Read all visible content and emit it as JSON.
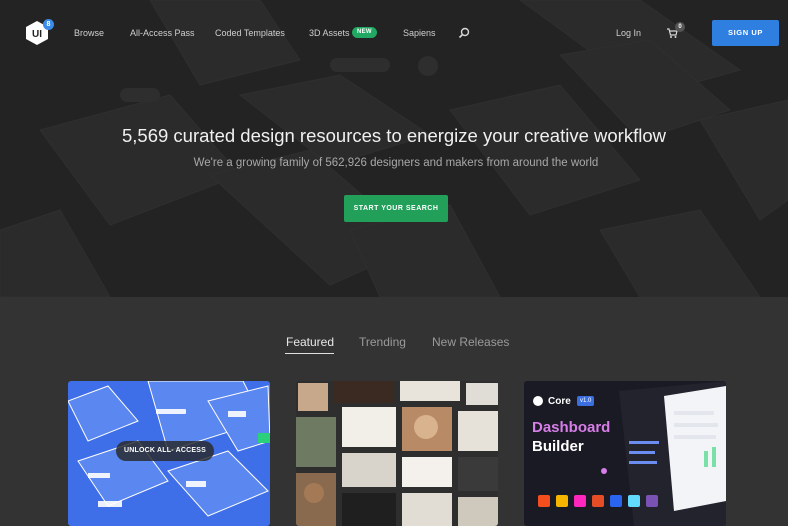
{
  "nav": {
    "logo_text": "UI",
    "logo_badge": "8",
    "links": [
      "Browse",
      "All-Access Pass",
      "Coded Templates",
      "3D Assets",
      "Sapiens"
    ],
    "new_badge": "NEW",
    "login": "Log In",
    "cart_count": "0",
    "signup": "SIGN UP"
  },
  "hero": {
    "headline": "5,569 curated design resources to energize your creative workflow",
    "subline": "We're a growing family of 562,926 designers and makers from around the world",
    "cta": "START YOUR SEARCH"
  },
  "tabs": {
    "featured": "Featured",
    "trending": "Trending",
    "new_releases": "New Releases"
  },
  "cards": {
    "card1": {
      "overlay": "UNLOCK ALL- ACCESS"
    },
    "card3": {
      "brand": "Core",
      "version": "v1.0",
      "title_line1": "Dashboard",
      "title_line2": "Builder"
    }
  },
  "colors": {
    "hero_bg": "#232323",
    "page_bg": "#333333",
    "signup": "#2f7fe0",
    "cta": "#22a05a",
    "new_badge": "#21a862"
  }
}
